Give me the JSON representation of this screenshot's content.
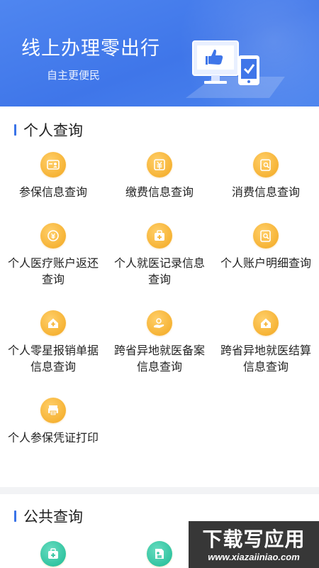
{
  "banner": {
    "title": "线上办理零出行",
    "subtitle": "自主更便民"
  },
  "personal": {
    "title": "个人查询",
    "items": [
      {
        "label": "参保信息查询",
        "icon": "insurance-card-icon"
      },
      {
        "label": "缴费信息查询",
        "icon": "payment-yuan-icon"
      },
      {
        "label": "消费信息查询",
        "icon": "consumption-search-icon"
      },
      {
        "label": "个人医疗账户返还查询",
        "icon": "refund-coin-icon"
      },
      {
        "label": "个人就医记录信息查询",
        "icon": "medical-kit-icon"
      },
      {
        "label": "个人账户明细查询",
        "icon": "account-detail-icon"
      },
      {
        "label": "个人零星报销单据信息查询",
        "icon": "home-reimburse-icon"
      },
      {
        "label": "跨省异地就医备案信息查询",
        "icon": "hand-record-icon"
      },
      {
        "label": "跨省异地就医结算信息查询",
        "icon": "home-settle-icon"
      },
      {
        "label": "个人参保凭证打印",
        "icon": "print-certificate-icon"
      }
    ]
  },
  "public": {
    "title": "公共查询",
    "items": [
      {
        "icon": "medical-kit-icon"
      },
      {
        "icon": "medical-document-icon"
      }
    ]
  },
  "watermark": {
    "main": "下载写应用",
    "sub": "www.xiazaiiniao.com"
  },
  "colors": {
    "banner": "#4a80ee",
    "accent": "#3a73e8",
    "icon_orange": "#f6b335",
    "icon_green": "#2fc39f"
  }
}
